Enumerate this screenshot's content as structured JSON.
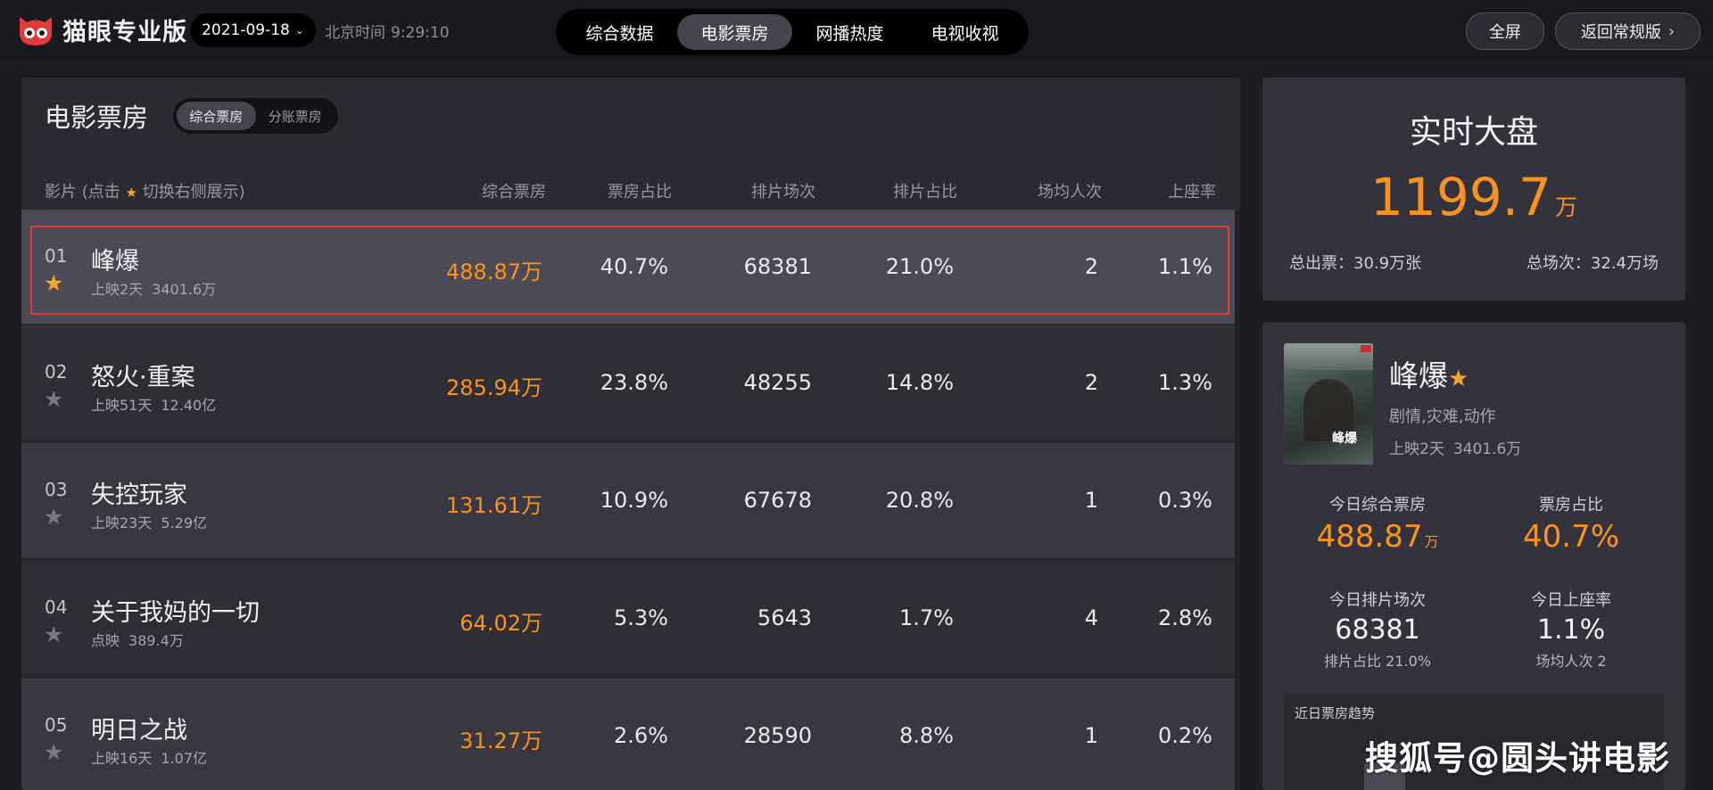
{
  "header": {
    "brand": "猫眼专业版",
    "date": "2021-09-18",
    "clock_label": "北京时间",
    "clock_time": "9:29:10",
    "tabs": [
      "综合数据",
      "电影票房",
      "网播热度",
      "电视收视"
    ],
    "active_tab": "电影票房",
    "fullscreen_label": "全屏",
    "back_label": "返回常规版"
  },
  "boxoffice": {
    "title": "电影票房",
    "toggle": [
      "综合票房",
      "分账票房"
    ],
    "columns": {
      "film_prefix": "影片 (点击",
      "film_suffix": "切换右侧展示)",
      "box": "综合票房",
      "box_share": "票房占比",
      "shows": "排片场次",
      "show_share": "排片占比",
      "avg_people": "场均人次",
      "occupancy": "上座率"
    },
    "rows": [
      {
        "rank": "01",
        "name": "峰爆",
        "days": "上映2天",
        "total": "3401.6万",
        "box": "488.87万",
        "box_share": "40.7%",
        "shows": "68381",
        "show_share": "21.0%",
        "avg": "2",
        "occ": "1.1%",
        "starred": true
      },
      {
        "rank": "02",
        "name": "怒火·重案",
        "days": "上映51天",
        "total": "12.40亿",
        "box": "285.94万",
        "box_share": "23.8%",
        "shows": "48255",
        "show_share": "14.8%",
        "avg": "2",
        "occ": "1.3%",
        "starred": false
      },
      {
        "rank": "03",
        "name": "失控玩家",
        "days": "上映23天",
        "total": "5.29亿",
        "box": "131.61万",
        "box_share": "10.9%",
        "shows": "67678",
        "show_share": "20.8%",
        "avg": "1",
        "occ": "0.3%",
        "starred": false
      },
      {
        "rank": "04",
        "name": "关于我妈的一切",
        "days": "点映",
        "total": "389.4万",
        "box": "64.02万",
        "box_share": "5.3%",
        "shows": "5643",
        "show_share": "1.7%",
        "avg": "4",
        "occ": "2.8%",
        "starred": false
      },
      {
        "rank": "05",
        "name": "明日之战",
        "days": "上映16天",
        "total": "1.07亿",
        "box": "31.27万",
        "box_share": "2.6%",
        "shows": "28590",
        "show_share": "8.8%",
        "avg": "1",
        "occ": "0.2%",
        "starred": false
      }
    ]
  },
  "realtime": {
    "title": "实时大盘",
    "value": "1199.7",
    "unit": "万",
    "tickets": "总出票：30.9万张",
    "shows": "总场次：32.4万场"
  },
  "detail": {
    "poster_title": "峰爆",
    "name": "峰爆",
    "genre": "剧情,灾难,动作",
    "days": "上映2天",
    "total": "3401.6万",
    "today_box_label": "今日综合票房",
    "today_box": "488.87",
    "today_box_unit": "万",
    "box_share_label": "票房占比",
    "box_share": "40.7%",
    "shows_label": "今日排片场次",
    "shows": "68381",
    "show_share": "排片占比 21.0%",
    "occ_label": "今日上座率",
    "occ": "1.1%",
    "avg": "场均人次 2",
    "trend_label": "近日票房趋势"
  },
  "watermark": "搜狐号@圆头讲电影",
  "colors": {
    "accent": "#f7931e",
    "star": "#f5a623",
    "highlight": "#e63b3b"
  }
}
